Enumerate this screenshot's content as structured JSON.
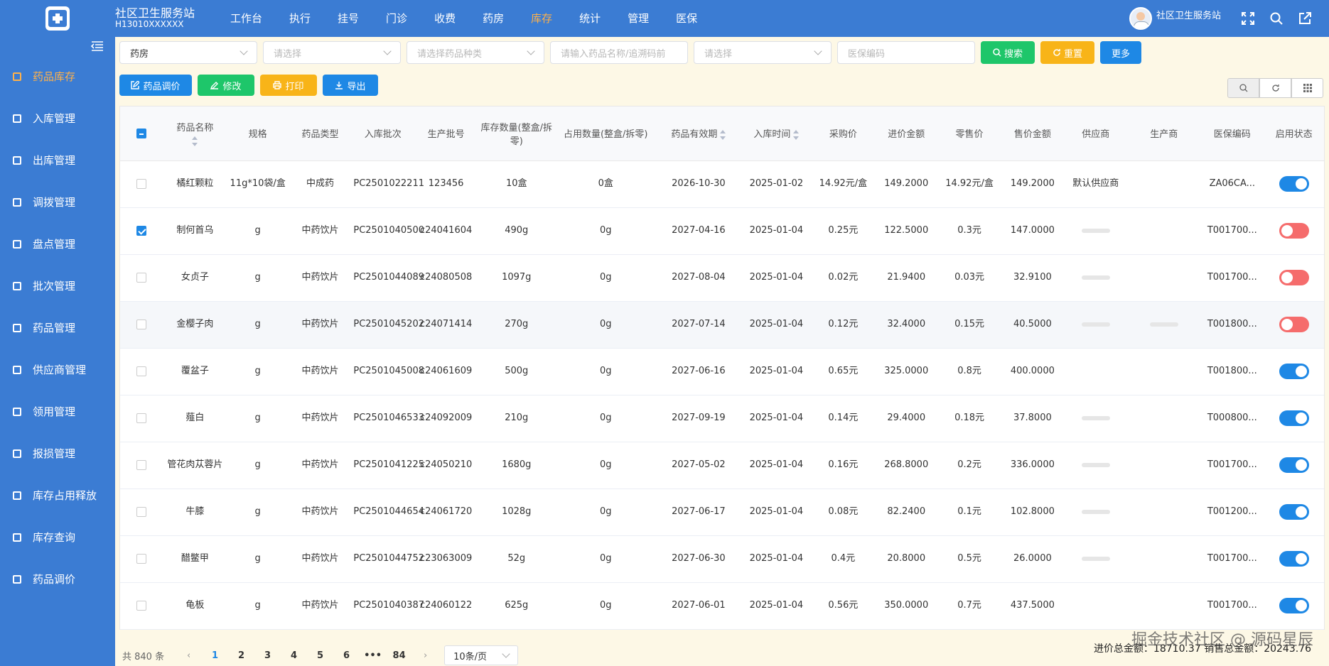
{
  "header": {
    "title": "社区卫生服务站",
    "code": "H13010XXXXXX",
    "nav": [
      "工作台",
      "执行",
      "挂号",
      "门诊",
      "收费",
      "药房",
      "库存",
      "统计",
      "管理",
      "医保"
    ],
    "active_nav": "库存",
    "username": "社区卫生服务站",
    "icons": [
      "fullscreen-icon",
      "search-icon",
      "external-link-icon"
    ]
  },
  "sidebar": {
    "items": [
      "药品库存",
      "入库管理",
      "出库管理",
      "调拨管理",
      "盘点管理",
      "批次管理",
      "药品管理",
      "供应商管理",
      "领用管理",
      "报损管理",
      "库存占用释放",
      "库存查询",
      "药品调价"
    ],
    "active": "药品库存"
  },
  "filters": {
    "pharmacy": "药房",
    "select1_placeholder": "请选择",
    "drug_type_placeholder": "请选择药品种类",
    "name_placeholder": "请输入药品名称/追溯码前",
    "select2_placeholder": "请选择",
    "insurance_placeholder": "医保编码",
    "search_label": "搜索",
    "reset_label": "重置",
    "more_label": "更多"
  },
  "actions": {
    "price_adjust": "药品调价",
    "edit": "修改",
    "print": "打印",
    "export": "导出"
  },
  "table": {
    "columns": [
      "药品名称",
      "规格",
      "药品类型",
      "入库批次",
      "生产批号",
      "库存数量(整盒/拆零)",
      "占用数量(整盒/拆零)",
      "药品有效期",
      "入库时间",
      "采购价",
      "进价金额",
      "零售价",
      "售价金额",
      "供应商",
      "生产商",
      "医保编码",
      "启用状态"
    ],
    "rows": [
      {
        "name": "橘红颗粒",
        "spec": "11g*10袋/盒",
        "type": "中成药",
        "batch": "PC2501022211",
        "lot": "123456",
        "stock": "10盒",
        "occupied": "0盒",
        "expiry": "2026-10-30",
        "in_date": "2025-01-02",
        "buy_price": "14.92元/盒",
        "buy_amount": "149.2000",
        "retail": "14.92元/盒",
        "sale_amount": "149.2000",
        "supplier": "默认供应商",
        "maker": "",
        "code": "ZA06CA...",
        "enabled": true,
        "checked": false
      },
      {
        "name": "制何首乌",
        "spec": "g",
        "type": "中药饮片",
        "batch": "PC2501040500",
        "lot": "c24041604",
        "stock": "490g",
        "occupied": "0g",
        "expiry": "2027-04-16",
        "in_date": "2025-01-04",
        "buy_price": "0.25元",
        "buy_amount": "122.5000",
        "retail": "0.3元",
        "sale_amount": "147.0000",
        "supplier": "",
        "maker": "",
        "code": "T001700...",
        "enabled": false,
        "checked": true
      },
      {
        "name": "女贞子",
        "spec": "g",
        "type": "中药饮片",
        "batch": "PC2501044089",
        "lot": "c24080508",
        "stock": "1097g",
        "occupied": "0g",
        "expiry": "2027-08-04",
        "in_date": "2025-01-04",
        "buy_price": "0.02元",
        "buy_amount": "21.9400",
        "retail": "0.03元",
        "sale_amount": "32.9100",
        "supplier": "",
        "maker": "",
        "code": "T001700...",
        "enabled": false,
        "checked": false
      },
      {
        "name": "金樱子肉",
        "spec": "g",
        "type": "中药饮片",
        "batch": "PC2501045202",
        "lot": "c24071414",
        "stock": "270g",
        "occupied": "0g",
        "expiry": "2027-07-14",
        "in_date": "2025-01-04",
        "buy_price": "0.12元",
        "buy_amount": "32.4000",
        "retail": "0.15元",
        "sale_amount": "40.5000",
        "supplier": "",
        "maker": "",
        "code": "T001800...",
        "enabled": false,
        "checked": false
      },
      {
        "name": "覆盆子",
        "spec": "g",
        "type": "中药饮片",
        "batch": "PC2501045008",
        "lot": "c24061609",
        "stock": "500g",
        "occupied": "0g",
        "expiry": "2027-06-16",
        "in_date": "2025-01-04",
        "buy_price": "0.65元",
        "buy_amount": "325.0000",
        "retail": "0.8元",
        "sale_amount": "400.0000",
        "supplier": "",
        "maker": "",
        "code": "T001800...",
        "enabled": true,
        "checked": false
      },
      {
        "name": "薤白",
        "spec": "g",
        "type": "中药饮片",
        "batch": "PC2501046533",
        "lot": "c24092009",
        "stock": "210g",
        "occupied": "0g",
        "expiry": "2027-09-19",
        "in_date": "2025-01-04",
        "buy_price": "0.14元",
        "buy_amount": "29.4000",
        "retail": "0.18元",
        "sale_amount": "37.8000",
        "supplier": "",
        "maker": "",
        "code": "T000800...",
        "enabled": true,
        "checked": false
      },
      {
        "name": "管花肉苁蓉片",
        "spec": "g",
        "type": "中药饮片",
        "batch": "PC2501041225",
        "lot": "c24050210",
        "stock": "1680g",
        "occupied": "0g",
        "expiry": "2027-05-02",
        "in_date": "2025-01-04",
        "buy_price": "0.16元",
        "buy_amount": "268.8000",
        "retail": "0.2元",
        "sale_amount": "336.0000",
        "supplier": "",
        "maker": "",
        "code": "T001700...",
        "enabled": true,
        "checked": false
      },
      {
        "name": "牛膝",
        "spec": "g",
        "type": "中药饮片",
        "batch": "PC2501044654",
        "lot": "c24061720",
        "stock": "1028g",
        "occupied": "0g",
        "expiry": "2027-06-17",
        "in_date": "2025-01-04",
        "buy_price": "0.08元",
        "buy_amount": "82.2400",
        "retail": "0.1元",
        "sale_amount": "102.8000",
        "supplier": "",
        "maker": "",
        "code": "T001200...",
        "enabled": true,
        "checked": false
      },
      {
        "name": "醋鳖甲",
        "spec": "g",
        "type": "中药饮片",
        "batch": "PC2501044752",
        "lot": "c23063009",
        "stock": "52g",
        "occupied": "0g",
        "expiry": "2027-06-30",
        "in_date": "2025-01-04",
        "buy_price": "0.4元",
        "buy_amount": "20.8000",
        "retail": "0.5元",
        "sale_amount": "26.0000",
        "supplier": "",
        "maker": "",
        "code": "T001700...",
        "enabled": true,
        "checked": false
      },
      {
        "name": "龟板",
        "spec": "g",
        "type": "中药饮片",
        "batch": "PC2501040387",
        "lot": "c24060122",
        "stock": "625g",
        "occupied": "0g",
        "expiry": "2027-06-01",
        "in_date": "2025-01-04",
        "buy_price": "0.56元",
        "buy_amount": "350.0000",
        "retail": "0.7元",
        "sale_amount": "437.5000",
        "supplier": "",
        "maker": "",
        "code": "T001700...",
        "enabled": true,
        "checked": false
      }
    ]
  },
  "pagination": {
    "total": "共 840 条",
    "pages": [
      "1",
      "2",
      "3",
      "4",
      "5",
      "6",
      "•••",
      "84"
    ],
    "current": "1",
    "page_size": "10条/页"
  },
  "summary": "进价总金额：18710.37 销售总金额：20243.76",
  "watermark": "掘金技术社区 @ 源码星辰",
  "colors": {
    "primary": "#3b7cd3",
    "accent": "#ffb14a",
    "green": "#1ec66a",
    "orange": "#f8b418",
    "blue": "#1e88e5",
    "red": "#f56c6c"
  }
}
